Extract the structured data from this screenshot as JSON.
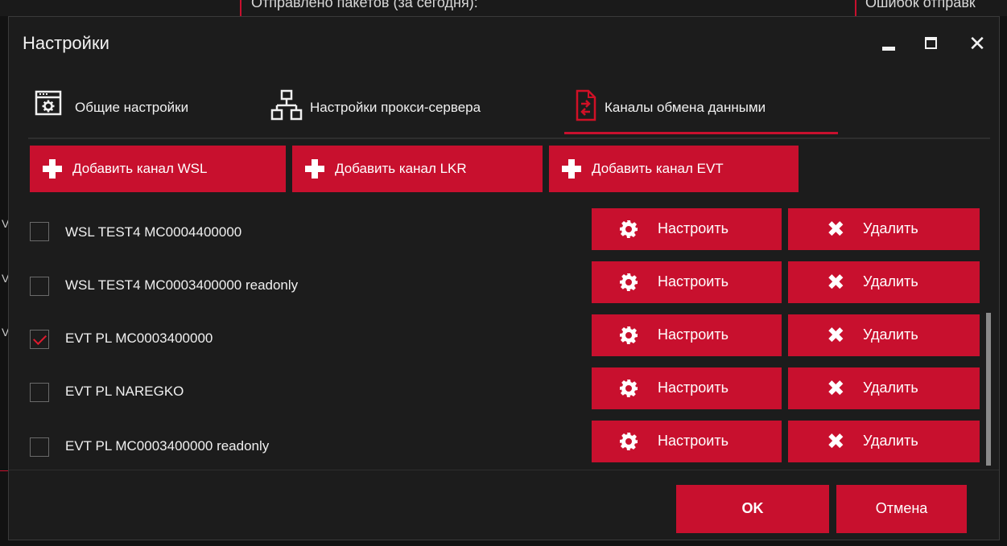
{
  "background": {
    "left_text": "Отправлено пакетов (за сегодня):",
    "right_text": "Ошибок отправк",
    "accent": "#c8102e",
    "fringe": [
      "V",
      "V",
      "V"
    ]
  },
  "dialog": {
    "title": "Настройки",
    "window_buttons": [
      "minimize-icon",
      "maximize-icon",
      "close-icon"
    ],
    "close_glyph": "✕"
  },
  "tabs": [
    {
      "label": "Общие настройки",
      "icon": "settings-window-icon",
      "active": false
    },
    {
      "label": "Настройки прокси-сервера",
      "icon": "network-icon",
      "active": false
    },
    {
      "label": "Каналы обмена данными",
      "icon": "exchange-document-icon",
      "active": true
    }
  ],
  "add_buttons": [
    {
      "label": "Добавить канал WSL",
      "icon": "plus-icon"
    },
    {
      "label": "Добавить канал LKR",
      "icon": "plus-icon"
    },
    {
      "label": "Добавить канал EVT",
      "icon": "plus-icon"
    }
  ],
  "channels": [
    {
      "name": "WSL TEST4 MC0004400000",
      "checked": false
    },
    {
      "name": "WSL TEST4 MC0003400000 readonly",
      "checked": false
    },
    {
      "name": "EVT PL MC0003400000",
      "checked": true
    },
    {
      "name": "EVT PL NAREGKO",
      "checked": false
    },
    {
      "name": "EVT PL MC0003400000 readonly",
      "checked": false
    }
  ],
  "row_actions": {
    "configure_label": "Настроить",
    "configure_icon": "gear-icon",
    "delete_label": "Удалить",
    "delete_icon": "x-icon",
    "delete_glyph": "✖"
  },
  "footer": {
    "ok_label": "OK",
    "cancel_label": "Отмена"
  },
  "colors": {
    "accent": "#c8102e",
    "dialog_bg": "#1c1c1c",
    "text": "#f0f0f0"
  }
}
